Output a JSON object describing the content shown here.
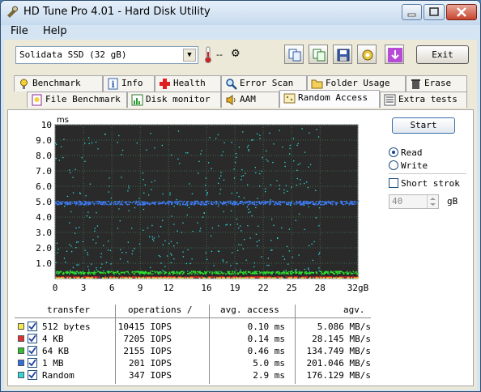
{
  "window": {
    "title": "HD Tune Pro 4.01 - Hard Disk Utility"
  },
  "menu": {
    "file": "File",
    "help": "Help"
  },
  "toolbar": {
    "drive": "Solidata SSD (32 gB)",
    "temperature": "--",
    "exit_label": "Exit"
  },
  "tabs": {
    "row1": [
      "Benchmark",
      "Info",
      "Health",
      "Error Scan",
      "Folder Usage",
      "Erase"
    ],
    "row2": [
      "File Benchmark",
      "Disk monitor",
      "AAM",
      "Random Access",
      "Extra tests"
    ],
    "active": "Random Access"
  },
  "controls": {
    "start_label": "Start",
    "read_label": "Read",
    "write_label": "Write",
    "short_stroke_label": "Short strok",
    "short_stroke_value": "40",
    "short_stroke_unit": "gB",
    "mode": "Read"
  },
  "colors": {
    "plot_bg": "#2a2a2a",
    "grid": "#3f6a4a",
    "s512": "#f3e94a",
    "s4k": "#ff2020",
    "s64k": "#2ee82e",
    "s1mb": "#3f7fff",
    "srand": "#30e0e0"
  },
  "chart_data": {
    "type": "scatter",
    "y_unit": "ms",
    "x_unit": "gB",
    "ylim": [
      0,
      10
    ],
    "xlim": [
      0,
      32
    ],
    "y_ticks": [
      "10",
      "9.0",
      "8.0",
      "7.0",
      "6.0",
      "5.0",
      "4.0",
      "3.0",
      "2.0",
      "1.0"
    ],
    "x_ticks": [
      "0",
      "3",
      "6",
      "9",
      "12",
      "16",
      "19",
      "22",
      "25",
      "28",
      "32gB"
    ],
    "series": [
      {
        "name": "512 bytes",
        "typical_ms": 0.1
      },
      {
        "name": "4 KB",
        "typical_ms": 0.14
      },
      {
        "name": "64 KB",
        "typical_ms": 0.46
      },
      {
        "name": "1 MB",
        "typical_ms": 5.0
      },
      {
        "name": "Random",
        "typical_ms": 2.9
      }
    ]
  },
  "results": {
    "headers": [
      "transfer",
      "operations /",
      "avg. access",
      "agv."
    ],
    "rows": [
      {
        "label": "512 bytes",
        "color": "#f3e94a",
        "ops": "10415 IOPS",
        "access": "0.10 ms",
        "rate": "5.086 MB/s"
      },
      {
        "label": "4 KB",
        "color": "#e03030",
        "ops": "7205 IOPS",
        "access": "0.14 ms",
        "rate": "28.145 MB/s"
      },
      {
        "label": "64 KB",
        "color": "#30c030",
        "ops": "2155 IOPS",
        "access": "0.46 ms",
        "rate": "134.749 MB/s"
      },
      {
        "label": "1 MB",
        "color": "#2f6fdf",
        "ops": "201 IOPS",
        "access": "5.0 ms",
        "rate": "201.046 MB/s"
      },
      {
        "label": "Random",
        "color": "#30d8d8",
        "ops": "347 IOPS",
        "access": "2.9 ms",
        "rate": "176.129 MB/s"
      }
    ]
  }
}
